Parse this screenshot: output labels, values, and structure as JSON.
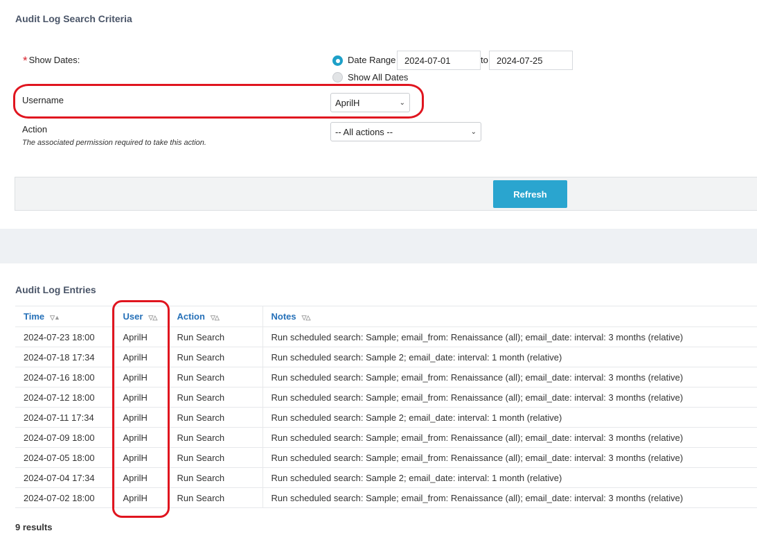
{
  "criteria": {
    "title": "Audit Log Search Criteria",
    "required_mark": "*",
    "show_dates_label": "Show Dates:",
    "date_range_label": "Date Range",
    "date_from": "2024-07-01",
    "to_label": "to",
    "date_to": "2024-07-25",
    "show_all_label": "Show All Dates",
    "username_label": "Username",
    "username_value": "AprilH",
    "action_label": "Action",
    "action_hint": "The associated permission required to take this action.",
    "action_value": "-- All actions --",
    "refresh_label": "Refresh"
  },
  "entries": {
    "title": "Audit Log Entries",
    "columns": [
      "Time",
      "User",
      "Action",
      "Notes"
    ],
    "rows": [
      [
        "2024-07-23 18:00",
        "AprilH",
        "Run Search",
        "Run scheduled search: Sample; email_from: Renaissance (all); email_date: interval: 3 months (relative)"
      ],
      [
        "2024-07-18 17:34",
        "AprilH",
        "Run Search",
        "Run scheduled search: Sample 2; email_date: interval: 1 month (relative)"
      ],
      [
        "2024-07-16 18:00",
        "AprilH",
        "Run Search",
        "Run scheduled search: Sample; email_from: Renaissance (all); email_date: interval: 3 months (relative)"
      ],
      [
        "2024-07-12 18:00",
        "AprilH",
        "Run Search",
        "Run scheduled search: Sample; email_from: Renaissance (all); email_date: interval: 3 months (relative)"
      ],
      [
        "2024-07-11 17:34",
        "AprilH",
        "Run Search",
        "Run scheduled search: Sample 2; email_date: interval: 1 month (relative)"
      ],
      [
        "2024-07-09 18:00",
        "AprilH",
        "Run Search",
        "Run scheduled search: Sample; email_from: Renaissance (all); email_date: interval: 3 months (relative)"
      ],
      [
        "2024-07-05 18:00",
        "AprilH",
        "Run Search",
        "Run scheduled search: Sample; email_from: Renaissance (all); email_date: interval: 3 months (relative)"
      ],
      [
        "2024-07-04 17:34",
        "AprilH",
        "Run Search",
        "Run scheduled search: Sample 2; email_date: interval: 1 month (relative)"
      ],
      [
        "2024-07-02 18:00",
        "AprilH",
        "Run Search",
        "Run scheduled search: Sample; email_from: Renaissance (all); email_date: interval: 3 months (relative)"
      ]
    ],
    "results_label": "9 results"
  },
  "colors": {
    "accent": "#2aa5cf",
    "link": "#2570b8",
    "highlight": "#e0151f"
  }
}
